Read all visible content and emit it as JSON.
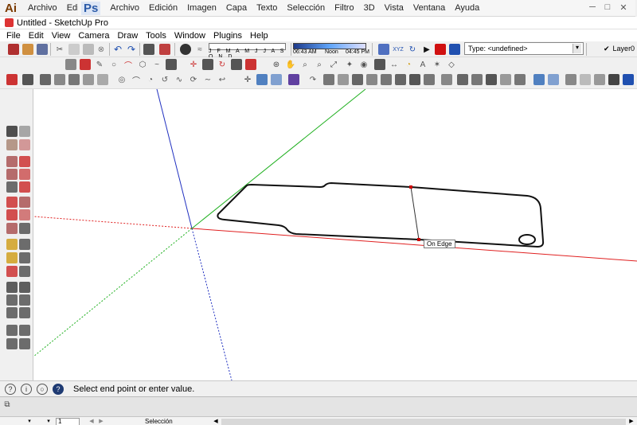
{
  "illustrator": {
    "logo": "Ai",
    "menu": [
      "Archivo",
      "Edición"
    ]
  },
  "photoshop": {
    "logo": "Ps",
    "menu": [
      "Archivo",
      "Edición",
      "Imagen",
      "Capa",
      "Texto",
      "Selección",
      "Filtro",
      "3D",
      "Vista",
      "Ventana",
      "Ayuda"
    ]
  },
  "window": {
    "title": "Untitled - SketchUp Pro"
  },
  "menubar": [
    "File",
    "Edit",
    "View",
    "Camera",
    "Draw",
    "Tools",
    "Window",
    "Plugins",
    "Help"
  ],
  "shadows": {
    "months": "J F M A M J J A S O N D",
    "time_start": "06:43 AM",
    "time_mid": "Noon",
    "time_end": "04:45 PM"
  },
  "layers": {
    "type_label": "Type: <undefined>",
    "current_layer": "Layer0"
  },
  "viewport": {
    "tooltip": "On Edge"
  },
  "statusbar": {
    "message": "Select end point or enter value."
  },
  "bottom": {
    "page_value": "1",
    "sheet_label": "Selección"
  },
  "colors": {
    "x_axis": "#e02020",
    "y_axis": "#20b020",
    "z_axis": "#2030c0",
    "inference_point": "#cc0000"
  }
}
